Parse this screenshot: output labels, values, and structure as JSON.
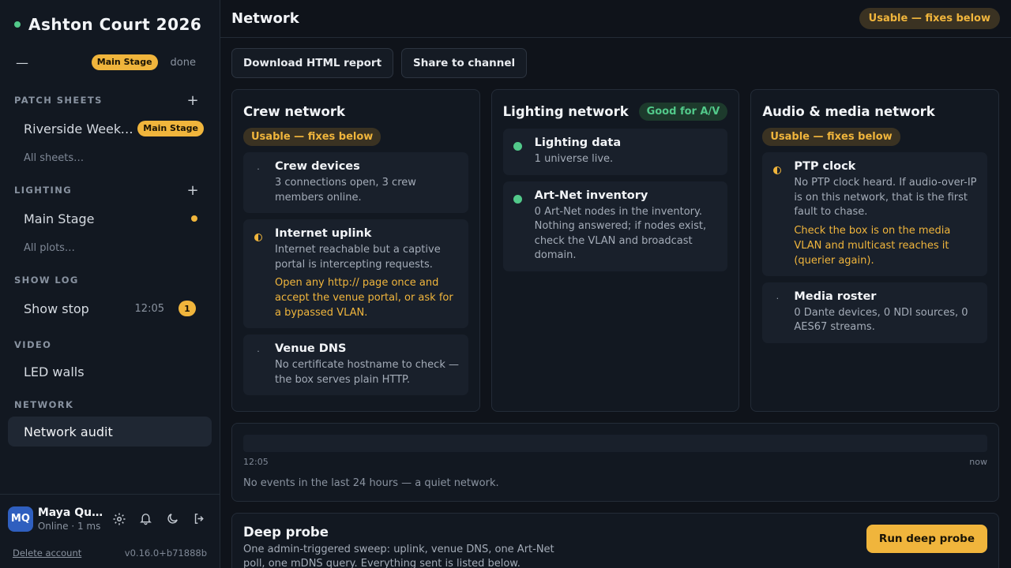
{
  "sidebar": {
    "app_title": "Ashton Court 2026",
    "stage_dash": "—",
    "stage_pill": "Main Stage",
    "stage_done": "done",
    "patch_sheets": {
      "label": "PATCH SHEETS",
      "item": "Riverside Weekend",
      "item_pill": "Main Stage",
      "all": "All sheets…"
    },
    "lighting": {
      "label": "LIGHTING",
      "item": "Main Stage",
      "all": "All plots…"
    },
    "show_log": {
      "label": "SHOW LOG",
      "item": "Show stop",
      "time": "12:05",
      "count": "1"
    },
    "video": {
      "label": "VIDEO",
      "item": "LED walls"
    },
    "network": {
      "label": "NETWORK",
      "item": "Network audit"
    },
    "user": {
      "initials": "MQ",
      "name": "Maya Quinn",
      "status": "Online · 1 ms"
    },
    "footer": {
      "delete": "Delete account",
      "version": "v0.16.0+b71888b"
    }
  },
  "main": {
    "title": "Network",
    "status_pill": "Usable — fixes below",
    "actions": {
      "download": "Download HTML report",
      "share": "Share to channel"
    },
    "columns": [
      {
        "title": "Crew network",
        "pill": "Usable — fixes below",
        "cards": [
          {
            "icon": "dot-icon",
            "title": "Crew devices",
            "desc": "3 connections open, 3 crew members online."
          },
          {
            "icon": "half-circle-warning-icon",
            "title": "Internet uplink",
            "desc": "Internet reachable but a captive portal is intercepting requests.",
            "fix": "Open any http:// page once and accept the venue portal, or ask for a bypassed VLAN."
          },
          {
            "icon": "dot-icon",
            "title": "Venue DNS",
            "desc": "No certificate hostname to check — the box serves plain HTTP."
          }
        ]
      },
      {
        "title": "Lighting network",
        "pill": "Good for A/V",
        "cards": [
          {
            "icon": "green-status-icon",
            "title": "Lighting data",
            "desc": "1 universe live."
          },
          {
            "icon": "green-status-icon",
            "title": "Art-Net inventory",
            "desc": "0 Art-Net nodes in the inventory. Nothing answered; if nodes exist, check the VLAN and broadcast domain."
          }
        ]
      },
      {
        "title": "Audio & media network",
        "pill": "Usable — fixes below",
        "cards": [
          {
            "icon": "half-circle-warning-icon",
            "title": "PTP clock",
            "desc": "No PTP clock heard. If audio-over-IP is on this network, that is the first fault to chase.",
            "fix": "Check the box is on the media VLAN and multicast reaches it (querier again)."
          },
          {
            "icon": "dot-icon",
            "title": "Media roster",
            "desc": "0 Dante devices, 0 NDI sources, 0 AES67 streams."
          }
        ]
      }
    ],
    "timeline": {
      "start": "12:05",
      "end": "now",
      "note": "No events in the last 24 hours — a quiet network."
    },
    "probe": {
      "title": "Deep probe",
      "desc": "One admin-triggered sweep: uplink, venue DNS, one Art-Net poll, one mDNS query. Everything sent is listed below.",
      "button": "Run deep probe"
    }
  },
  "colors": {
    "accent": "#f0b53c",
    "good": "#52c98a",
    "bg": "#0f131a"
  }
}
